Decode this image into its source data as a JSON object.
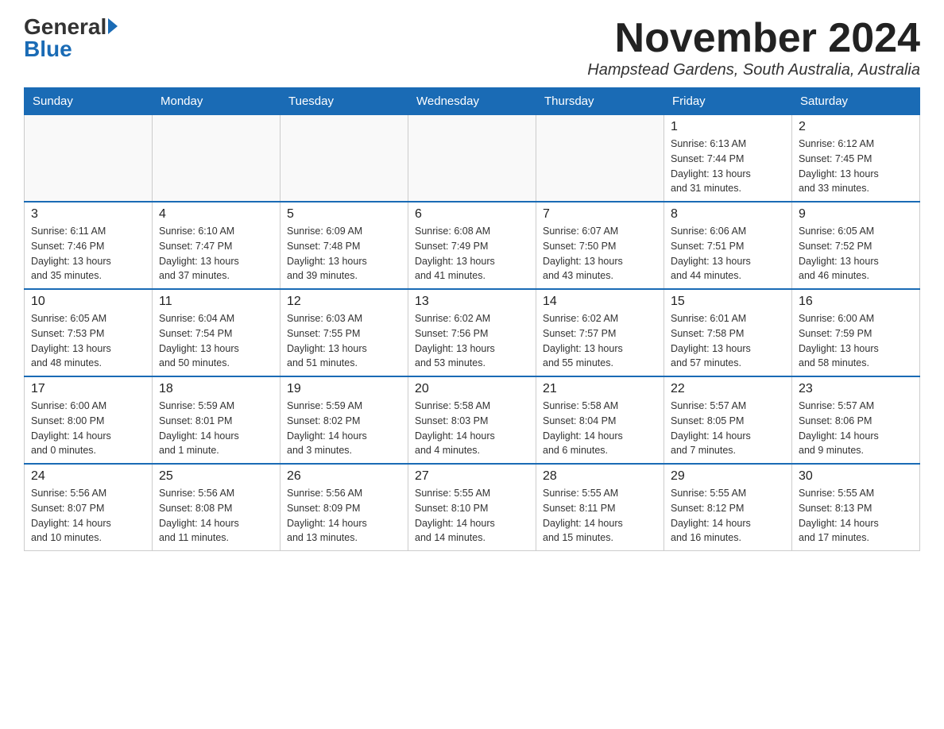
{
  "header": {
    "logo_general": "General",
    "logo_blue": "Blue",
    "month_title": "November 2024",
    "location": "Hampstead Gardens, South Australia, Australia"
  },
  "days_of_week": [
    "Sunday",
    "Monday",
    "Tuesday",
    "Wednesday",
    "Thursday",
    "Friday",
    "Saturday"
  ],
  "weeks": [
    {
      "days": [
        {
          "num": "",
          "info": ""
        },
        {
          "num": "",
          "info": ""
        },
        {
          "num": "",
          "info": ""
        },
        {
          "num": "",
          "info": ""
        },
        {
          "num": "",
          "info": ""
        },
        {
          "num": "1",
          "info": "Sunrise: 6:13 AM\nSunset: 7:44 PM\nDaylight: 13 hours\nand 31 minutes."
        },
        {
          "num": "2",
          "info": "Sunrise: 6:12 AM\nSunset: 7:45 PM\nDaylight: 13 hours\nand 33 minutes."
        }
      ]
    },
    {
      "days": [
        {
          "num": "3",
          "info": "Sunrise: 6:11 AM\nSunset: 7:46 PM\nDaylight: 13 hours\nand 35 minutes."
        },
        {
          "num": "4",
          "info": "Sunrise: 6:10 AM\nSunset: 7:47 PM\nDaylight: 13 hours\nand 37 minutes."
        },
        {
          "num": "5",
          "info": "Sunrise: 6:09 AM\nSunset: 7:48 PM\nDaylight: 13 hours\nand 39 minutes."
        },
        {
          "num": "6",
          "info": "Sunrise: 6:08 AM\nSunset: 7:49 PM\nDaylight: 13 hours\nand 41 minutes."
        },
        {
          "num": "7",
          "info": "Sunrise: 6:07 AM\nSunset: 7:50 PM\nDaylight: 13 hours\nand 43 minutes."
        },
        {
          "num": "8",
          "info": "Sunrise: 6:06 AM\nSunset: 7:51 PM\nDaylight: 13 hours\nand 44 minutes."
        },
        {
          "num": "9",
          "info": "Sunrise: 6:05 AM\nSunset: 7:52 PM\nDaylight: 13 hours\nand 46 minutes."
        }
      ]
    },
    {
      "days": [
        {
          "num": "10",
          "info": "Sunrise: 6:05 AM\nSunset: 7:53 PM\nDaylight: 13 hours\nand 48 minutes."
        },
        {
          "num": "11",
          "info": "Sunrise: 6:04 AM\nSunset: 7:54 PM\nDaylight: 13 hours\nand 50 minutes."
        },
        {
          "num": "12",
          "info": "Sunrise: 6:03 AM\nSunset: 7:55 PM\nDaylight: 13 hours\nand 51 minutes."
        },
        {
          "num": "13",
          "info": "Sunrise: 6:02 AM\nSunset: 7:56 PM\nDaylight: 13 hours\nand 53 minutes."
        },
        {
          "num": "14",
          "info": "Sunrise: 6:02 AM\nSunset: 7:57 PM\nDaylight: 13 hours\nand 55 minutes."
        },
        {
          "num": "15",
          "info": "Sunrise: 6:01 AM\nSunset: 7:58 PM\nDaylight: 13 hours\nand 57 minutes."
        },
        {
          "num": "16",
          "info": "Sunrise: 6:00 AM\nSunset: 7:59 PM\nDaylight: 13 hours\nand 58 minutes."
        }
      ]
    },
    {
      "days": [
        {
          "num": "17",
          "info": "Sunrise: 6:00 AM\nSunset: 8:00 PM\nDaylight: 14 hours\nand 0 minutes."
        },
        {
          "num": "18",
          "info": "Sunrise: 5:59 AM\nSunset: 8:01 PM\nDaylight: 14 hours\nand 1 minute."
        },
        {
          "num": "19",
          "info": "Sunrise: 5:59 AM\nSunset: 8:02 PM\nDaylight: 14 hours\nand 3 minutes."
        },
        {
          "num": "20",
          "info": "Sunrise: 5:58 AM\nSunset: 8:03 PM\nDaylight: 14 hours\nand 4 minutes."
        },
        {
          "num": "21",
          "info": "Sunrise: 5:58 AM\nSunset: 8:04 PM\nDaylight: 14 hours\nand 6 minutes."
        },
        {
          "num": "22",
          "info": "Sunrise: 5:57 AM\nSunset: 8:05 PM\nDaylight: 14 hours\nand 7 minutes."
        },
        {
          "num": "23",
          "info": "Sunrise: 5:57 AM\nSunset: 8:06 PM\nDaylight: 14 hours\nand 9 minutes."
        }
      ]
    },
    {
      "days": [
        {
          "num": "24",
          "info": "Sunrise: 5:56 AM\nSunset: 8:07 PM\nDaylight: 14 hours\nand 10 minutes."
        },
        {
          "num": "25",
          "info": "Sunrise: 5:56 AM\nSunset: 8:08 PM\nDaylight: 14 hours\nand 11 minutes."
        },
        {
          "num": "26",
          "info": "Sunrise: 5:56 AM\nSunset: 8:09 PM\nDaylight: 14 hours\nand 13 minutes."
        },
        {
          "num": "27",
          "info": "Sunrise: 5:55 AM\nSunset: 8:10 PM\nDaylight: 14 hours\nand 14 minutes."
        },
        {
          "num": "28",
          "info": "Sunrise: 5:55 AM\nSunset: 8:11 PM\nDaylight: 14 hours\nand 15 minutes."
        },
        {
          "num": "29",
          "info": "Sunrise: 5:55 AM\nSunset: 8:12 PM\nDaylight: 14 hours\nand 16 minutes."
        },
        {
          "num": "30",
          "info": "Sunrise: 5:55 AM\nSunset: 8:13 PM\nDaylight: 14 hours\nand 17 minutes."
        }
      ]
    }
  ]
}
